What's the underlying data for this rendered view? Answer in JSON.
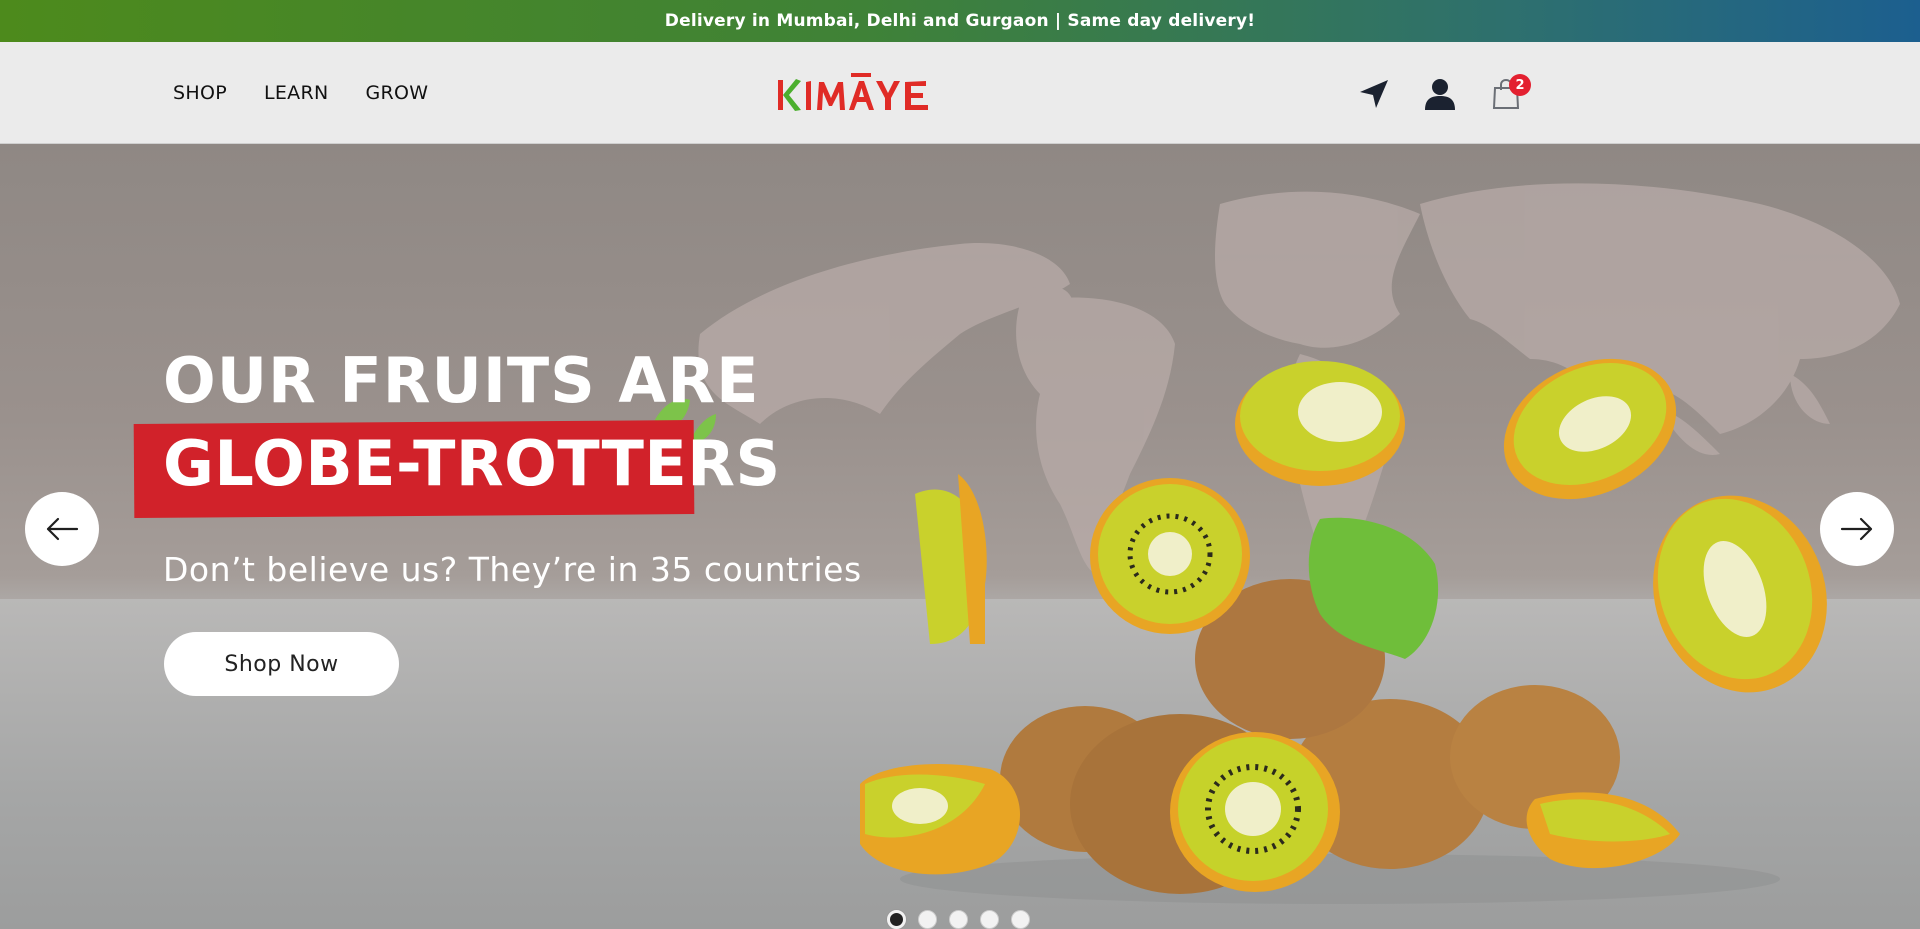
{
  "announcement": {
    "text": "Delivery in Mumbai, Delhi and Gurgaon | Same day delivery!"
  },
  "nav": {
    "items": [
      {
        "label": "SHOP"
      },
      {
        "label": "LEARN"
      },
      {
        "label": "GROW"
      }
    ]
  },
  "logo": {
    "text": "KIMĀYE",
    "color": "#e02b26",
    "accent": "#4caf2e"
  },
  "header_icons": {
    "location": "location-arrow-icon",
    "account": "user-icon",
    "cart": "shopping-bag-icon",
    "cart_count": "2"
  },
  "hero": {
    "headline_line1": "OUR FRUITS ARE",
    "headline_line2": "GLOBE-TROTTERS",
    "subtitle": "Don’t believe us? They’re in 35 countries",
    "cta": "Shop Now",
    "prev_icon": "arrow-left-icon",
    "next_icon": "arrow-right-icon",
    "accent_color": "#d1222a"
  },
  "carousel": {
    "slides": 5,
    "active": 1
  }
}
